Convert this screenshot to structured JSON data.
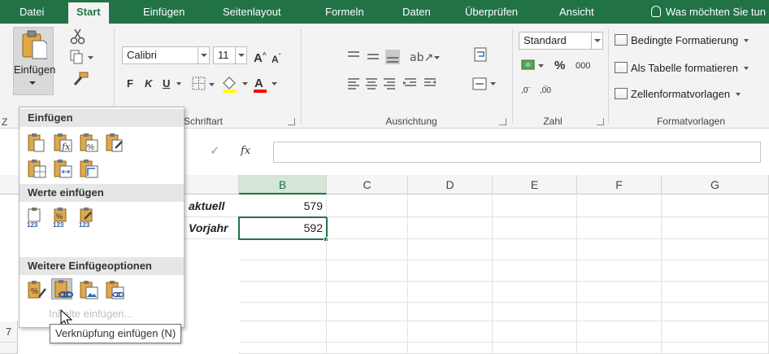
{
  "tabs": [
    "Datei",
    "Start",
    "Einfügen",
    "Seitenlayout",
    "Formeln",
    "Daten",
    "Überprüfen",
    "Ansicht"
  ],
  "active_tab": "Start",
  "tell_me": "Was möchten Sie tun",
  "ribbon": {
    "clipboard": {
      "paste_label": "Einfügen"
    },
    "font": {
      "name": "Calibri",
      "size": "11",
      "bold": "F",
      "italic": "K",
      "underline": "U",
      "group_label": "Schriftart"
    },
    "alignment": {
      "group_label": "Ausrichtung"
    },
    "number": {
      "format": "Standard",
      "percent": "%",
      "thousands": "000",
      "group_label": "Zahl"
    },
    "styles": {
      "conditional": "Bedingte Formatierung",
      "as_table": "Als Tabelle formatieren",
      "cell_styles": "Zellenformatvorlagen",
      "group_label": "Formatvorlagen"
    },
    "clipped_group_label": "Z"
  },
  "formula_bar": {
    "fx": "fx",
    "value": ""
  },
  "columns": [
    "B",
    "C",
    "D",
    "E",
    "F",
    "G"
  ],
  "selected_column": "B",
  "rows": [
    {
      "label": "aktuell",
      "value": "579"
    },
    {
      "label": "Vorjahr",
      "value": "592"
    }
  ],
  "visible_row_number": "7",
  "paste_menu": {
    "section1": "Einfügen",
    "section2": "Werte einfügen",
    "section3": "Weitere Einfügeoptionen",
    "value_badge": "123",
    "faded_text": "Inhalte einfügen...",
    "tooltip": "Verknüpfung einfügen (N)"
  },
  "colors": {
    "excel_green": "#217346",
    "ribbon_bg": "#f3f3f3",
    "menu_header": "#e6e6e6"
  }
}
